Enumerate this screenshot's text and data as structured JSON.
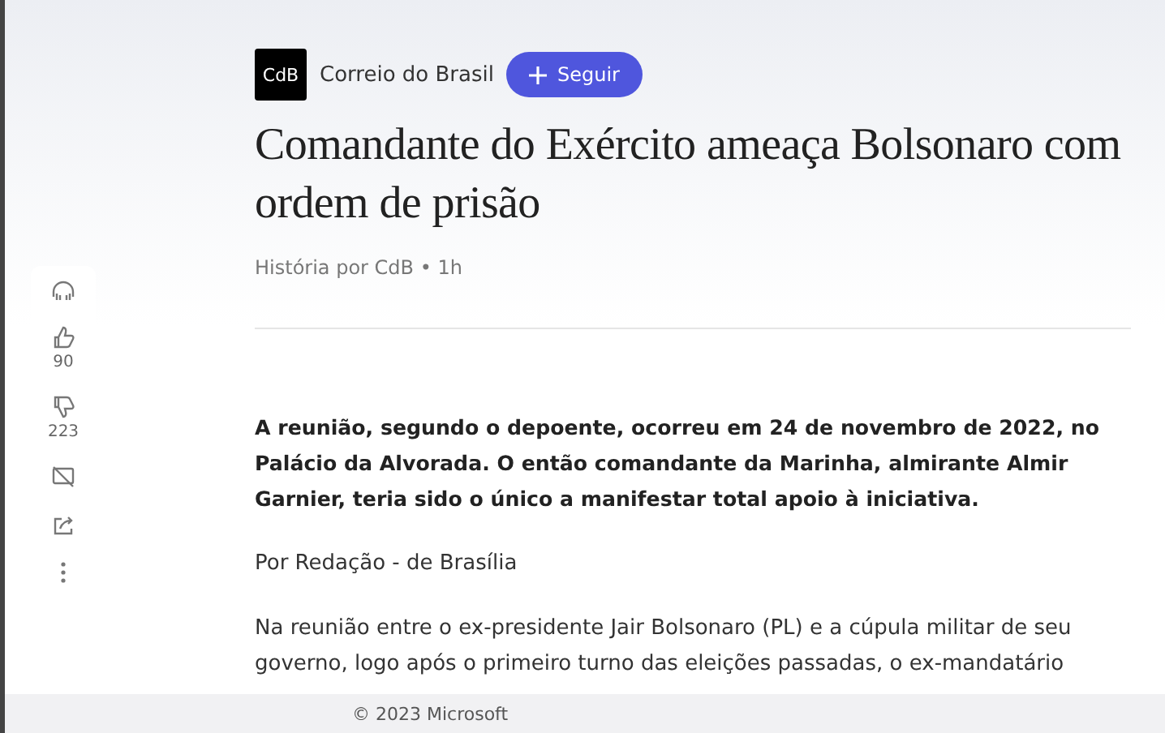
{
  "publisher": {
    "logo": "CdB",
    "name": "Correio do Brasil",
    "follow_button": "Seguir"
  },
  "headline": "Comandante do Exército ameaça Bolsonaro com ordem de prisão",
  "byline": "História por CdB • 1h",
  "actions": [
    {
      "kind": "listen"
    },
    {
      "kind": "like",
      "count": "90"
    },
    {
      "kind": "dislike",
      "count": "223"
    },
    {
      "kind": "hide"
    },
    {
      "kind": "share"
    },
    {
      "kind": "more"
    }
  ],
  "lead": "A reunião, segundo o depoente, ocorreu em 24 de novembro de 2022, no Palácio da Alvorada. O então comandante da Marinha, almirante Almir Garnier, teria sido o único a manifestar total apoio à iniciativa.",
  "paragraphs": [
    "Por Redação - de Brasília",
    "Na reunião entre o ex-presidente Jair Bolsonaro (PL) e a cúpula militar de seu governo, logo após o primeiro turno das eleições passadas, o ex-mandatário"
  ],
  "footer": "© 2023 Microsoft"
}
